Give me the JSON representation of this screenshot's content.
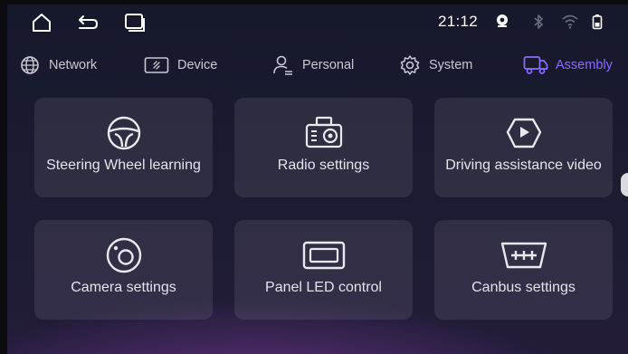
{
  "status_bar": {
    "time": "21:12",
    "icons": [
      "home-icon",
      "back-icon",
      "recents-icon",
      "location-icon",
      "bluetooth-icon",
      "wifi-icon",
      "battery-icon"
    ]
  },
  "tabs": [
    {
      "label": "Network",
      "icon": "globe-icon",
      "active": false
    },
    {
      "label": "Device",
      "icon": "device-icon",
      "active": false
    },
    {
      "label": "Personal",
      "icon": "person-icon",
      "active": false
    },
    {
      "label": "System",
      "icon": "gear-icon",
      "active": false
    },
    {
      "label": "Assembly",
      "icon": "truck-icon",
      "active": true
    }
  ],
  "tiles": [
    {
      "label": "Steering Wheel learning",
      "icon": "steering-wheel-icon"
    },
    {
      "label": "Radio settings",
      "icon": "radio-icon"
    },
    {
      "label": "Driving assistance video",
      "icon": "play-video-icon"
    },
    {
      "label": "Camera settings",
      "icon": "camera-icon"
    },
    {
      "label": "Panel LED control",
      "icon": "led-panel-icon"
    },
    {
      "label": "Canbus settings",
      "icon": "canbus-icon"
    }
  ],
  "colors": {
    "accent": "#8a6dff",
    "text": "#e4e4ec",
    "tile_bg": "#2a2a3e",
    "background": "#1b1b31"
  }
}
